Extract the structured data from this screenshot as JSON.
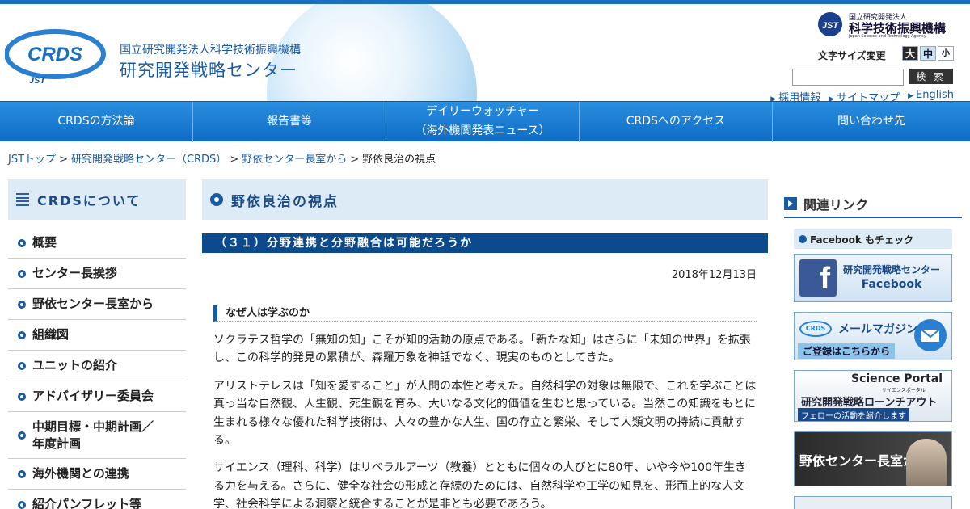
{
  "header": {
    "logo_text": "CRDS",
    "logo_sub": "JST",
    "org_line1": "国立研究開発法人科学技術振興機構",
    "org_line2": "研究開発戦略センター",
    "jst_small": "国立研究開発法人",
    "jst_big": "科学技術振興機構",
    "jst_eng": "Japan Science and Technology Agency",
    "fontsize_label": "文字サイズ変更",
    "fontsize_options": [
      "大",
      "中",
      "小"
    ],
    "search_placeholder": "",
    "search_button": "検 索",
    "links": [
      "採用情報",
      "サイトマップ",
      "English"
    ]
  },
  "nav": {
    "items": [
      {
        "line1": "CRDSの方法論",
        "line2": ""
      },
      {
        "line1": "報告書等",
        "line2": ""
      },
      {
        "line1": "デイリーウォッチャー",
        "line2": "（海外機関発表ニュース）"
      },
      {
        "line1": "CRDSへのアクセス",
        "line2": ""
      },
      {
        "line1": "問い合わせ先",
        "line2": ""
      }
    ]
  },
  "breadcrumb": [
    "JSTトップ",
    "研究開発戦略センター（CRDS）",
    "野依センター長室から",
    "野依良治の視点"
  ],
  "sidebar": {
    "title": "CRDSについて",
    "items": [
      "概要",
      "センター長挨拶",
      "野依センター長室から",
      "組織図",
      "ユニットの紹介",
      "アドバイザリー委員会",
      "中期目標・中期計画／\n年度計画",
      "海外機関との連携",
      "紹介パンフレット等"
    ]
  },
  "main": {
    "page_title": "野依良治の視点",
    "article_title": "（３１）分野連携と分野融合は可能だろうか",
    "date": "2018年12月13日",
    "subhead": "なぜ人は学ぶのか",
    "paragraphs": [
      "ソクラテス哲学の「無知の知」こそが知的活動の原点である。「新たな知」はさらに「未知の世界」を拡張し、この科学的発見の累積が、森羅万象を神話でなく、現実のものとしてきた。",
      "アリストテレスは「知を愛すること」が人間の本性と考えた。自然科学の対象は無限で、これを学ぶことは真っ当な自然観、人生観、死生観を育み、大いなる文化的価値を生むと思っている。当然この知識をもとに生まれる様々な優れた科学技術は、人々の豊かな人生、国の存立と繁栄、そして人類文明の持続に貢献する。",
      "サイエンス（理科、科学）はリベラルアーツ（教養）とともに個々の人びとに80年、いや今や100年生きる力を与える。さらに、健全な社会の形成と存続のためには、自然科学や工学の知見を、形而上的な人文学、社会科学による洞察と統合することが是非とも必要であろう。"
    ]
  },
  "right": {
    "title": "関連リンク",
    "facebook_check": "Facebook もチェック",
    "fb_banner": [
      "研究開発戦略センター",
      "Facebook"
    ],
    "mail_banner": [
      "メールマガジン",
      "ご登録はこちらから"
    ],
    "sp_banner": [
      "Science Portal",
      "サイエンスポータル",
      "研究開発戦略ローンチアウト",
      "フェローの活動を紹介します"
    ],
    "noyori_banner": "野依センター長室から"
  }
}
